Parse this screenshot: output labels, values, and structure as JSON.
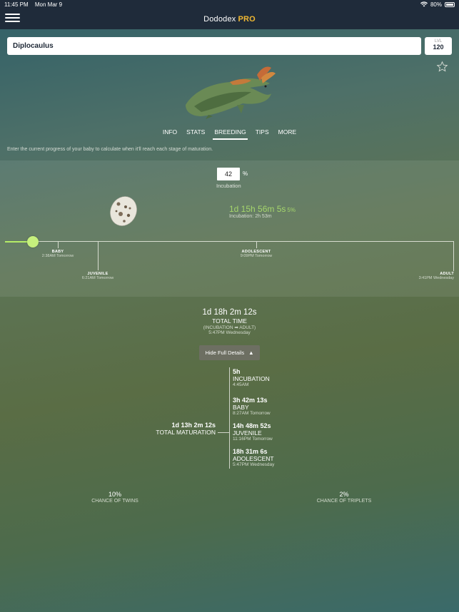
{
  "status": {
    "time": "11:45 PM",
    "date": "Mon Mar 9",
    "battery": "80%"
  },
  "nav": {
    "title": "Dododex",
    "pro": "PRO"
  },
  "search": {
    "value": "Diplocaulus"
  },
  "level": {
    "label": "LVL",
    "value": "120"
  },
  "tabs": [
    {
      "label": "INFO",
      "active": false
    },
    {
      "label": "STATS",
      "active": false
    },
    {
      "label": "BREEDING",
      "active": true
    },
    {
      "label": "TIPS",
      "active": false
    },
    {
      "label": "MORE",
      "active": false
    }
  ],
  "hint": "Enter the current progress of your baby to calculate when it'll reach each stage of maturation.",
  "progress": {
    "value": "42",
    "unit": "%",
    "label": "Incubation",
    "countdown": "1d 15h 56m 5s",
    "countdown_pct": "5%",
    "sub": "Incubation: 2h 53m",
    "slider_fraction": 0.05
  },
  "stages": [
    {
      "name": "BABY",
      "time": "2:38AM Tomorrow"
    },
    {
      "name": "JUVENILE",
      "time": "6:21AM Tomorrow"
    },
    {
      "name": "ADOLESCENT",
      "time": "9:09PM Tomorrow"
    },
    {
      "name": "ADULT",
      "time": "3:41PM Wednesday"
    }
  ],
  "summary": {
    "total": "1d 18h 2m 12s",
    "label": "TOTAL TIME",
    "sub": "(INCUBATION ➡ ADULT)",
    "when": "5:47PM Wednesday",
    "toggle": "Hide Full Details",
    "toggle_icon": "▲"
  },
  "details": [
    {
      "duration": "5h",
      "name": "INCUBATION",
      "time": "4:45AM"
    },
    {
      "duration": "3h 42m 13s",
      "name": "BABY",
      "time": "8:27AM Tomorrow"
    },
    {
      "duration": "14h 48m 52s",
      "name": "JUVENILE",
      "time": "11:16PM Tomorrow"
    },
    {
      "duration": "18h 31m 6s",
      "name": "ADOLESCENT",
      "time": "5:47PM Wednesday"
    }
  ],
  "maturation": {
    "duration": "1d 13h 2m 12s",
    "label": "TOTAL MATURATION"
  },
  "chances": {
    "twins": {
      "value": "10%",
      "label": "CHANCE OF TWINS"
    },
    "triplets": {
      "value": "2%",
      "label": "CHANCE OF TRIPLETS"
    }
  }
}
